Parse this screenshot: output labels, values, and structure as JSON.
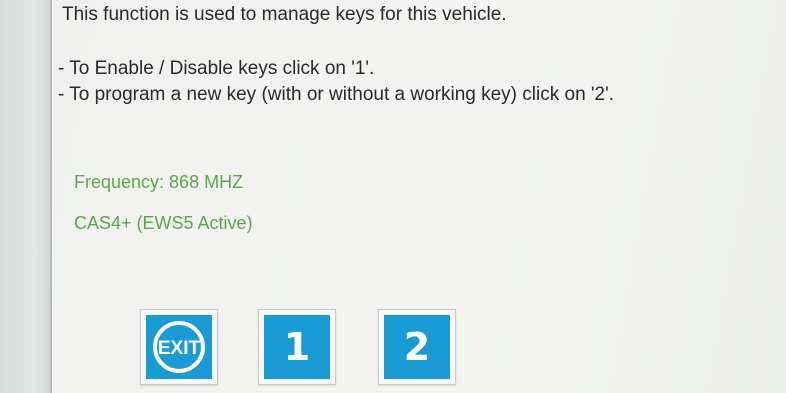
{
  "message": {
    "title": "This function is used to manage keys for this vehicle.",
    "line1": "- To Enable / Disable keys click on '1'.",
    "line2": "- To program a new key (with or without a working key) click on '2'."
  },
  "info": {
    "frequency": "Frequency: 868 MHZ",
    "system": "CAS4+ (EWS5 Active)"
  },
  "buttons": {
    "exit_label": "EXIT",
    "one_label": "1",
    "two_label": "2"
  },
  "colors": {
    "button_blue": "#1a9bd5",
    "info_green": "#5aa84a"
  }
}
